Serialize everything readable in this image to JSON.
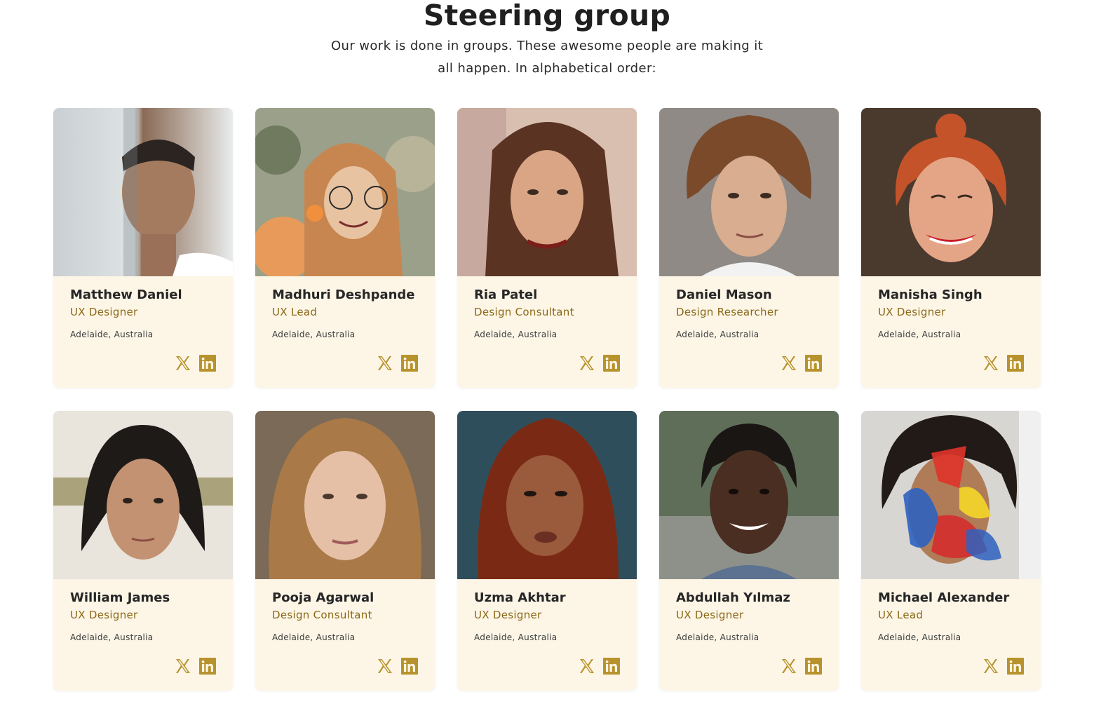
{
  "section": {
    "title": "Steering group",
    "subtitle": "Our work is done in groups. These awesome people are making it all happen. In alphabetical order:"
  },
  "colors": {
    "card_bg": "#fdf6e7",
    "accent": "#b8922c",
    "role_text": "#8a6716"
  },
  "members": [
    {
      "name": "Matthew Daniel",
      "role": "UX Designer",
      "location": "Adelaide, Australia",
      "x_icon": "x-icon",
      "linkedin_icon": "linkedin-icon"
    },
    {
      "name": "Madhuri Deshpande",
      "role": "UX Lead",
      "location": "Adelaide, Australia",
      "x_icon": "x-icon",
      "linkedin_icon": "linkedin-icon"
    },
    {
      "name": "Ria Patel",
      "role": "Design Consultant",
      "location": "Adelaide, Australia",
      "x_icon": "x-icon",
      "linkedin_icon": "linkedin-icon"
    },
    {
      "name": "Daniel Mason",
      "role": "Design Researcher",
      "location": "Adelaide, Australia",
      "x_icon": "x-icon",
      "linkedin_icon": "linkedin-icon"
    },
    {
      "name": "Manisha Singh",
      "role": "UX Designer",
      "location": "Adelaide, Australia",
      "x_icon": "x-icon",
      "linkedin_icon": "linkedin-icon"
    },
    {
      "name": "William James",
      "role": "UX Designer",
      "location": "Adelaide, Australia",
      "x_icon": "x-icon",
      "linkedin_icon": "linkedin-icon"
    },
    {
      "name": "Pooja Agarwal",
      "role": "Design Consultant",
      "location": "Adelaide, Australia",
      "x_icon": "x-icon",
      "linkedin_icon": "linkedin-icon"
    },
    {
      "name": "Uzma Akhtar",
      "role": "UX Designer",
      "location": "Adelaide, Australia",
      "x_icon": "x-icon",
      "linkedin_icon": "linkedin-icon"
    },
    {
      "name": "Abdullah Yılmaz",
      "role": "UX Designer",
      "location": "Adelaide, Australia",
      "x_icon": "x-icon",
      "linkedin_icon": "linkedin-icon"
    },
    {
      "name": "Michael Alexander",
      "role": "UX Lead",
      "location": "Adelaide, Australia",
      "x_icon": "x-icon",
      "linkedin_icon": "linkedin-icon"
    }
  ]
}
